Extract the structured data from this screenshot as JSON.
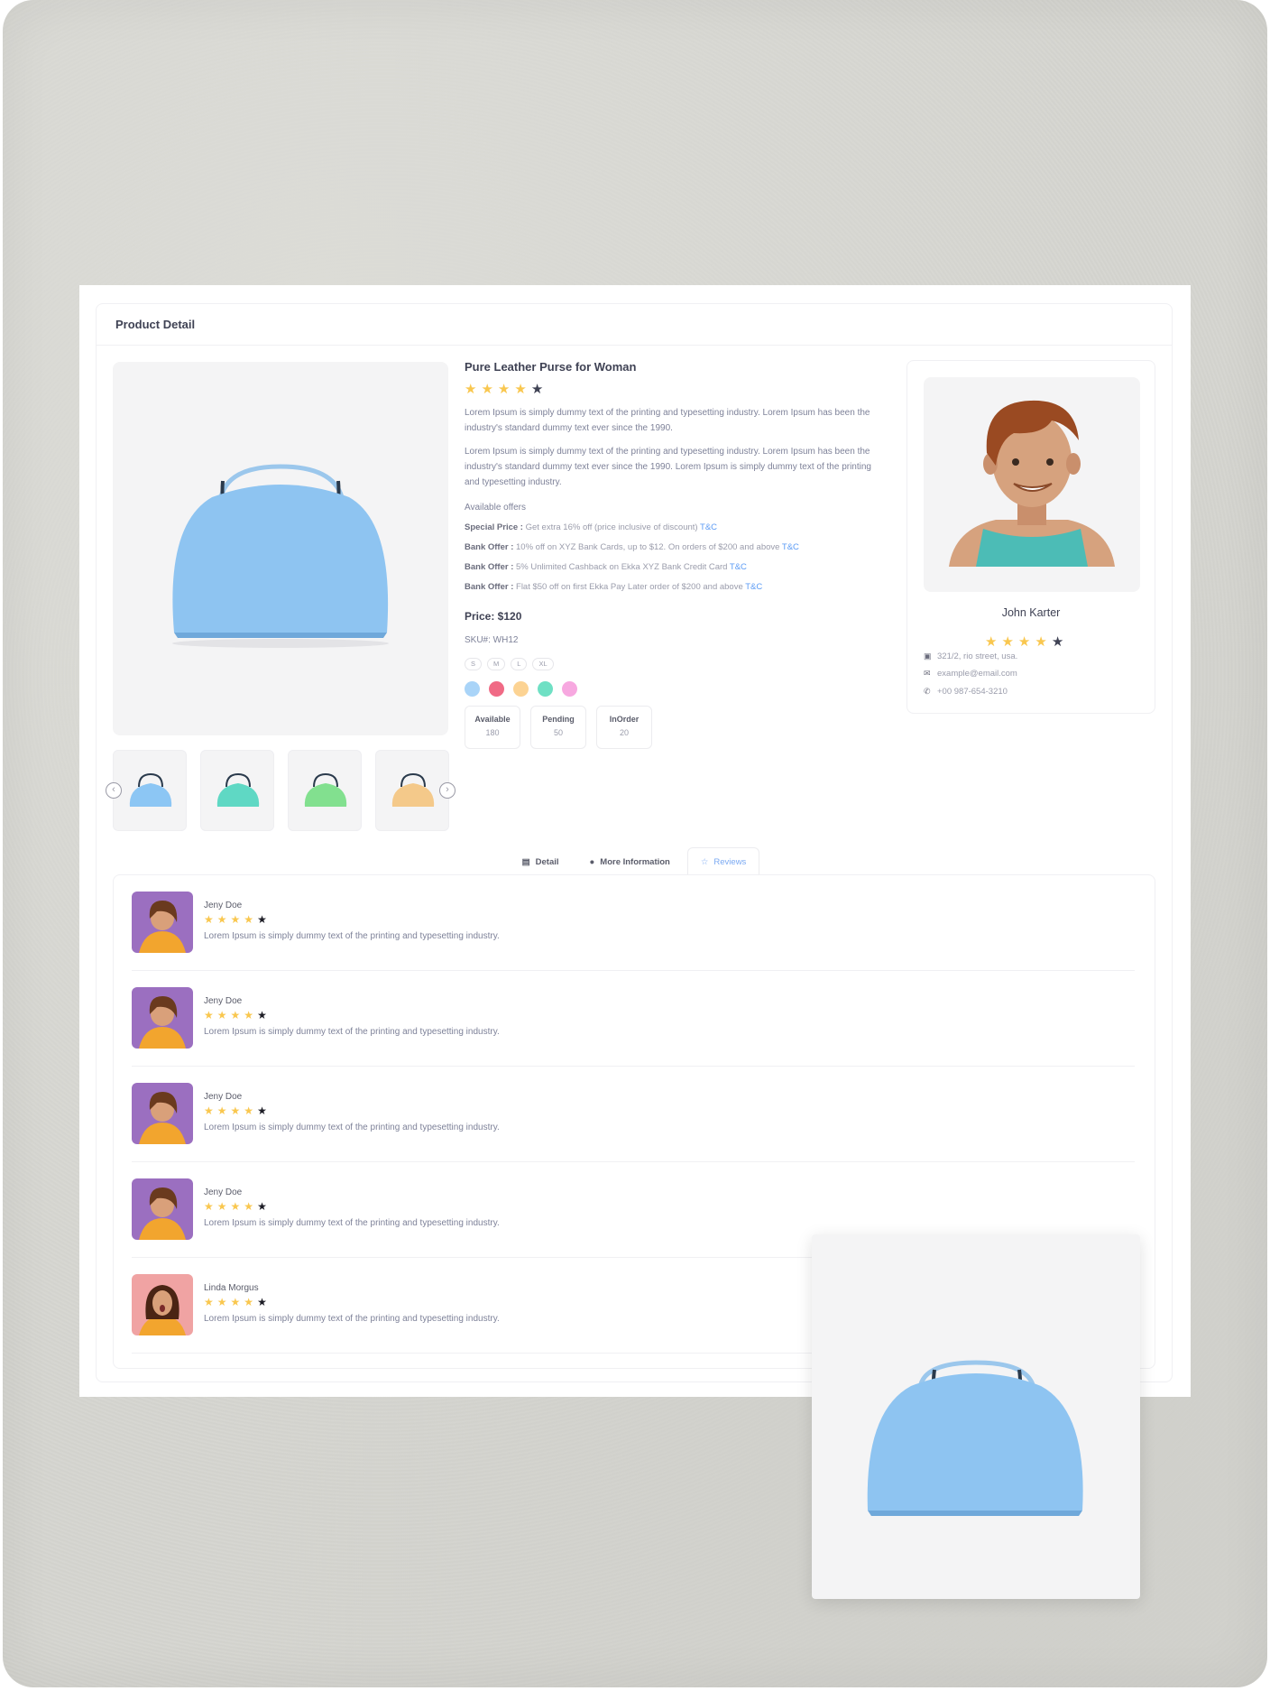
{
  "header": {
    "title": "Product Detail"
  },
  "product": {
    "title": "Pure Leather Purse for Woman",
    "rating": 4,
    "desc1": "Lorem Ipsum is simply dummy text of the printing and typesetting industry. Lorem Ipsum has been the industry's standard dummy text ever since the 1990.",
    "desc2": "Lorem Ipsum is simply dummy text of the printing and typesetting industry. Lorem Ipsum has been the industry's standard dummy text ever since the 1990. Lorem Ipsum is simply dummy text of the printing and typesetting industry.",
    "offers_heading": "Available offers",
    "offers": [
      {
        "label": "Special Price :",
        "text": "Get extra 16% off (price inclusive of discount)",
        "link": "T&C"
      },
      {
        "label": "Bank Offer :",
        "text": "10% off on XYZ Bank Cards, up to $12. On orders of $200 and above",
        "link": "T&C"
      },
      {
        "label": "Bank Offer :",
        "text": "5% Unlimited Cashback on Ekka XYZ Bank Credit Card",
        "link": "T&C"
      },
      {
        "label": "Bank Offer :",
        "text": "Flat $50 off on first Ekka Pay Later order of $200 and above",
        "link": "T&C"
      }
    ],
    "price": "Price: $120",
    "sku": "SKU#: WH12",
    "sizes": [
      "S",
      "M",
      "L",
      "XL"
    ],
    "colors": [
      "#a9d4f8",
      "#f06a85",
      "#fcd393",
      "#6fe0c4",
      "#f7a8e0"
    ],
    "stock": [
      {
        "label": "Available",
        "value": "180"
      },
      {
        "label": "Pending",
        "value": "50"
      },
      {
        "label": "InOrder",
        "value": "20"
      }
    ],
    "thumb_colors": [
      "#8cc6f4",
      "#5fd8c4",
      "#82e08f",
      "#f4c98a"
    ]
  },
  "seller": {
    "name": "John Karter",
    "rating": 4,
    "address": "321/2, rio street, usa.",
    "email": "example@email.com",
    "phone": "+00 987-654-3210"
  },
  "tabs": [
    {
      "label": "Detail",
      "icon": "document-icon"
    },
    {
      "label": "More Information",
      "icon": "info-icon"
    },
    {
      "label": "Reviews",
      "icon": "star-icon"
    }
  ],
  "reviews": [
    {
      "name": "Jeny Doe",
      "rating": 4,
      "text": "Lorem Ipsum is simply dummy text of the printing and typesetting industry."
    },
    {
      "name": "Jeny Doe",
      "rating": 4,
      "text": "Lorem Ipsum is simply dummy text of the printing and typesetting industry."
    },
    {
      "name": "Jeny Doe",
      "rating": 4,
      "text": "Lorem Ipsum is simply dummy text of the printing and typesetting industry."
    },
    {
      "name": "Jeny Doe",
      "rating": 4,
      "text": "Lorem Ipsum is simply dummy text of the printing and typesetting industry."
    },
    {
      "name": "Linda Morgus",
      "rating": 4,
      "text": "Lorem Ipsum is simply dummy text of the printing and typesetting industry."
    }
  ]
}
